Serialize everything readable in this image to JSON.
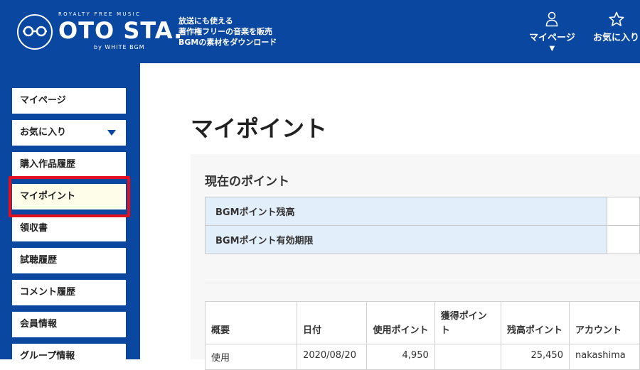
{
  "header": {
    "logo_top": "ROYALTY FREE MUSIC",
    "logo_main": "OTO STA.",
    "logo_sub": "by WHITE BGM",
    "tagline": [
      "放送にも使える",
      "著作権フリーの音楽を販売",
      "BGMの素材をダウンロード"
    ],
    "nav": [
      {
        "label": "マイページ",
        "icon": "user-icon",
        "arrow": "▼"
      },
      {
        "label": "お気に入り",
        "icon": "star-icon"
      }
    ]
  },
  "sidebar": {
    "items": [
      {
        "label": "マイページ"
      },
      {
        "label": "お気に入り",
        "has_dropdown": true
      },
      {
        "label": "購入作品履歴"
      },
      {
        "label": "マイポイント",
        "active": true
      },
      {
        "label": "領収書"
      },
      {
        "label": "試聴履歴"
      },
      {
        "label": "コメント履歴"
      },
      {
        "label": "会員情報"
      },
      {
        "label": "グループ情報"
      }
    ]
  },
  "main": {
    "title": "マイポイント",
    "current_points": {
      "heading": "現在のポイント",
      "rows": [
        {
          "label": "BGMポイント残高",
          "value": ""
        },
        {
          "label": "BGMポイント有効期限",
          "value": ""
        }
      ]
    },
    "history": {
      "columns": [
        "概要",
        "日付",
        "使用ポイント",
        "獲得ポイント",
        "残高ポイント",
        "アカウント"
      ],
      "rows": [
        [
          "使用",
          "2020/08/20",
          "4,950",
          "",
          "25,450",
          "nakashima"
        ]
      ]
    }
  },
  "colors": {
    "brand_blue": "#0a47a0",
    "highlight_red": "#e01020",
    "table_header_bg": "#e3eefb",
    "active_item_bg": "#fefde9"
  }
}
